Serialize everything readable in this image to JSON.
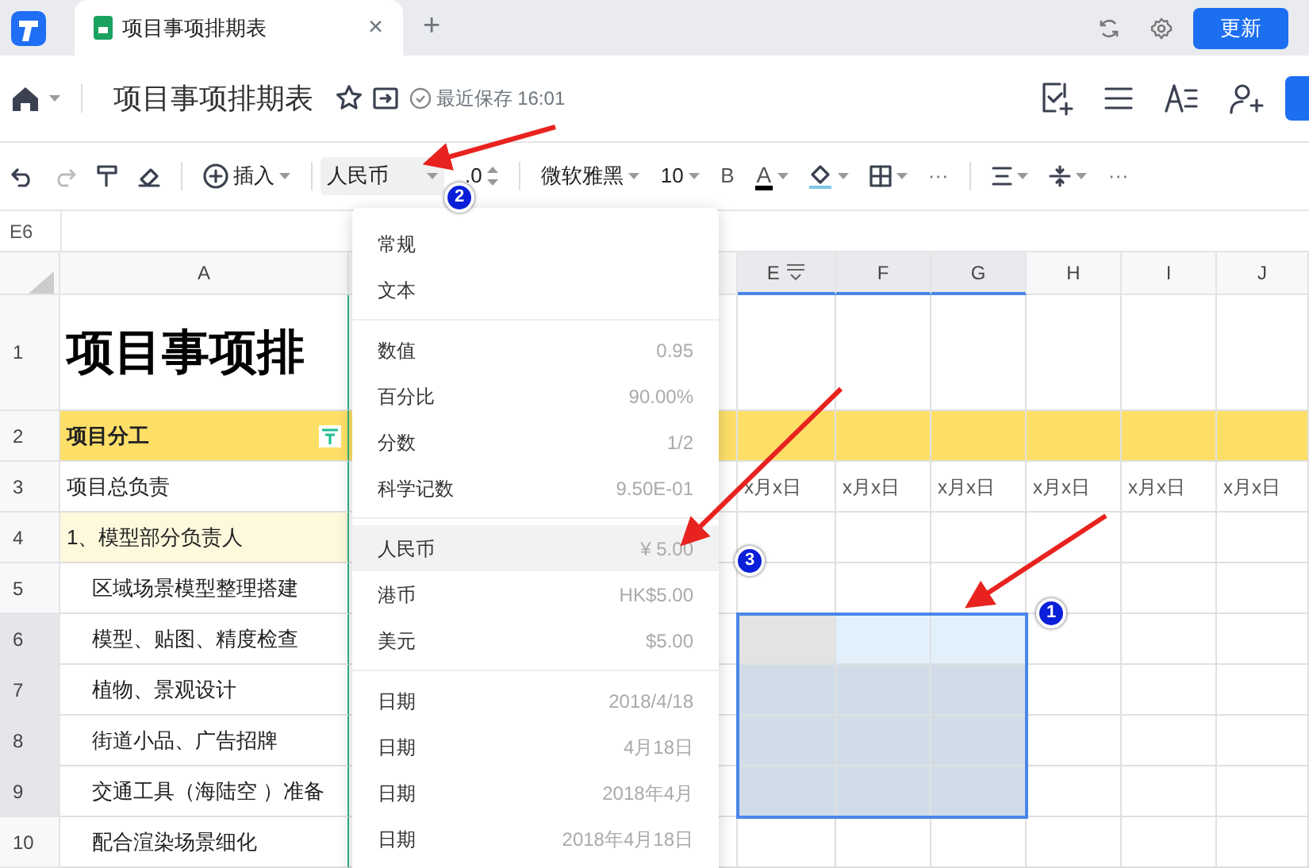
{
  "tabbar": {
    "tab_title": "项目事项排期表",
    "close": "×",
    "new_tab": "+",
    "update_button": "更新"
  },
  "header": {
    "title": "项目事项排期表",
    "save_status": "最近保存 16:01"
  },
  "toolbar": {
    "insert": "插入",
    "number_format": "人民币",
    "decimals": ".0",
    "font": "微软雅黑",
    "font_size": "10",
    "bold": "B",
    "font_color": "A",
    "more": "···",
    "more_right": "···"
  },
  "name_box": "E6",
  "sheet": {
    "columns": [
      {
        "label": "A",
        "selected": false
      },
      {
        "label": "E",
        "selected": true
      },
      {
        "label": "F",
        "selected": true
      },
      {
        "label": "G",
        "selected": true
      },
      {
        "label": "H",
        "selected": false
      },
      {
        "label": "I",
        "selected": false
      },
      {
        "label": "J",
        "selected": false
      }
    ],
    "rows": [
      {
        "number": "1",
        "kind": "title",
        "selected": false,
        "cells": [
          {
            "text": "项目事项排"
          }
        ]
      },
      {
        "number": "2",
        "kind": "band",
        "selected": false,
        "cells": [
          {
            "text": "项目分工"
          }
        ]
      },
      {
        "number": "3",
        "kind": "plain",
        "selected": false,
        "cells": [
          {
            "text": "项目总负责"
          },
          {
            "text": "x月x日"
          },
          {
            "text": "x月x日"
          },
          {
            "text": "x月x日"
          },
          {
            "text": "x月x日"
          },
          {
            "text": "x月x日"
          },
          {
            "text": "x月x日"
          }
        ]
      },
      {
        "number": "4",
        "kind": "section",
        "selected": false,
        "cells": [
          {
            "text": "1、模型部分负责人"
          }
        ]
      },
      {
        "number": "5",
        "kind": "item",
        "selected": false,
        "cells": [
          {
            "text": "区域场景模型整理搭建"
          }
        ]
      },
      {
        "number": "6",
        "kind": "item",
        "selected": true,
        "cells": [
          {
            "text": "模型、贴图、精度检查"
          },
          {
            "selected": true,
            "active": true
          },
          {
            "selected": true,
            "active": false
          },
          {
            "selected": true,
            "active": false
          },
          {
            "selected": false,
            "active": false
          },
          {
            "selected": false,
            "active": false
          },
          {
            "selected": false,
            "active": false
          }
        ]
      },
      {
        "number": "7",
        "kind": "item",
        "selected": true,
        "cells": [
          {
            "text": "植物、景观设计"
          },
          {
            "selected": true,
            "active": false
          },
          {
            "selected": true,
            "active": false
          },
          {
            "selected": true,
            "active": false
          },
          {
            "selected": false,
            "active": false
          },
          {
            "selected": false,
            "active": false
          },
          {
            "selected": false,
            "active": false
          }
        ]
      },
      {
        "number": "8",
        "kind": "item",
        "selected": true,
        "cells": [
          {
            "text": "街道小品、广告招牌"
          },
          {
            "selected": true,
            "active": false
          },
          {
            "selected": true,
            "active": false
          },
          {
            "selected": true,
            "active": false
          },
          {
            "selected": false,
            "active": false
          },
          {
            "selected": false,
            "active": false
          },
          {
            "selected": false,
            "active": false
          }
        ]
      },
      {
        "number": "9",
        "kind": "item",
        "selected": true,
        "cells": [
          {
            "text": "交通工具（海陆空 ）准备"
          },
          {
            "selected": true,
            "active": false
          },
          {
            "selected": true,
            "active": false
          },
          {
            "selected": true,
            "active": false
          },
          {
            "selected": false,
            "active": false
          },
          {
            "selected": false,
            "active": false
          },
          {
            "selected": false,
            "active": false
          }
        ]
      },
      {
        "number": "10",
        "kind": "item",
        "selected": false,
        "cells": [
          {
            "text": "配合渲染场景细化"
          }
        ]
      }
    ]
  },
  "format_menu": {
    "groups": [
      [
        {
          "label": "常规",
          "selected": false
        },
        {
          "label": "文本",
          "selected": false
        }
      ],
      [
        {
          "label": "数值",
          "example": "0.95",
          "selected": false
        },
        {
          "label": "百分比",
          "example": "90.00%",
          "selected": false
        },
        {
          "label": "分数",
          "example": "1/2",
          "selected": false
        },
        {
          "label": "科学记数",
          "example": "9.50E-01",
          "selected": false
        }
      ],
      [
        {
          "label": "人民币",
          "example": "¥ 5.00",
          "selected": true
        },
        {
          "label": "港币",
          "example": "HK$5.00",
          "selected": false
        },
        {
          "label": "美元",
          "example": "$5.00",
          "selected": false
        }
      ],
      [
        {
          "label": "日期",
          "example": "2018/4/18",
          "selected": false
        },
        {
          "label": "日期",
          "example": "4月18日",
          "selected": false
        },
        {
          "label": "日期",
          "example": "2018年4月",
          "selected": false
        },
        {
          "label": "日期",
          "example": "2018年4月18日",
          "selected": false
        }
      ]
    ]
  },
  "annotations": [
    {
      "number": "2"
    },
    {
      "number": "3"
    },
    {
      "number": "1"
    }
  ]
}
